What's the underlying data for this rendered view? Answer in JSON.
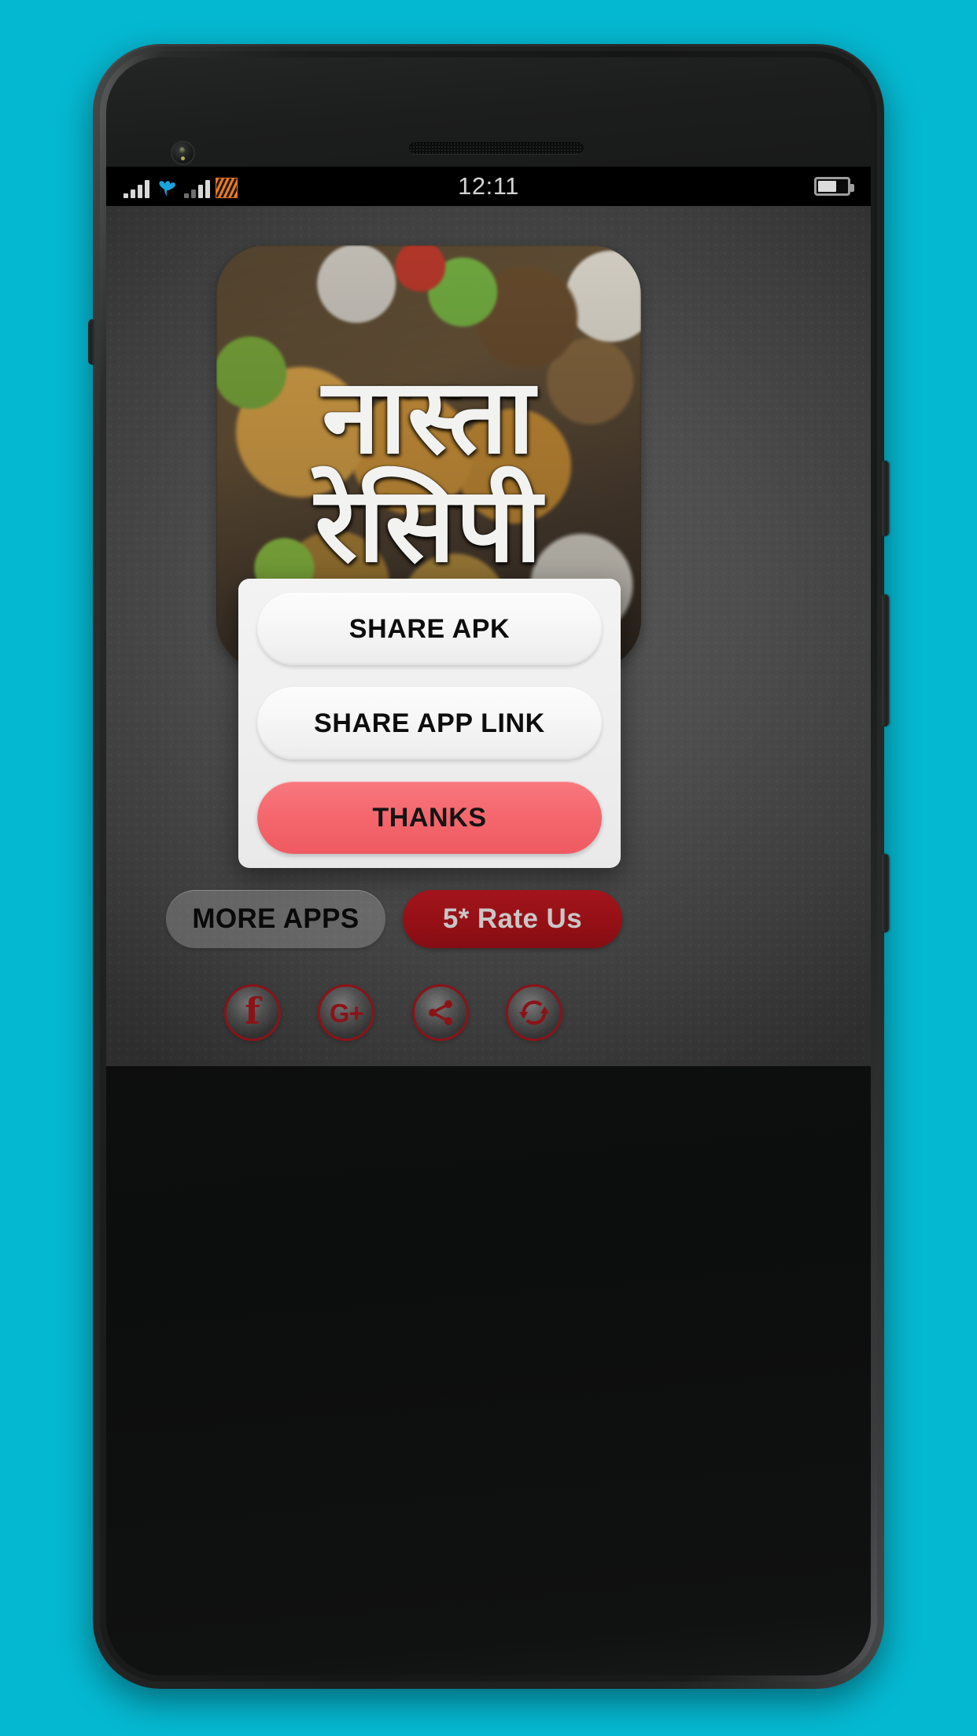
{
  "theme": {
    "backdrop_color": "#05b8d1",
    "accent_red": "#8b1318",
    "rate_button_color": "#951016",
    "thanks_button_color": "#f4686e",
    "screen_background": "#4e4e4e"
  },
  "status_bar": {
    "time": "12:11",
    "icons": [
      "signal-bars-icon",
      "telenor-logo-icon",
      "signal-bars-secondary-icon",
      "data-stripe-icon"
    ],
    "battery": {
      "name": "battery-icon",
      "level_percent": 58
    }
  },
  "app_logo": {
    "name": "app-logo-icon",
    "line1": "नास्ता",
    "line2": "रेसिपी",
    "alt": "Nasta Recipe app icon over fried snack food photo"
  },
  "dialog": {
    "name": "share-dialog",
    "buttons": [
      {
        "label": "SHARE APK",
        "style": "light",
        "name": "share-apk-button"
      },
      {
        "label": "SHARE APP LINK",
        "style": "light",
        "name": "share-app-link-button"
      },
      {
        "label": "THANKS",
        "style": "accent",
        "name": "thanks-button"
      }
    ]
  },
  "bottom_actions": {
    "more_apps_label": "MORE APPS",
    "rate_us_label": "5* Rate Us"
  },
  "social": {
    "items": [
      {
        "name": "facebook-icon",
        "label": "f"
      },
      {
        "name": "google-plus-icon",
        "label": "G+"
      },
      {
        "name": "share-icon",
        "label": ""
      },
      {
        "name": "refresh-icon",
        "label": ""
      }
    ]
  }
}
